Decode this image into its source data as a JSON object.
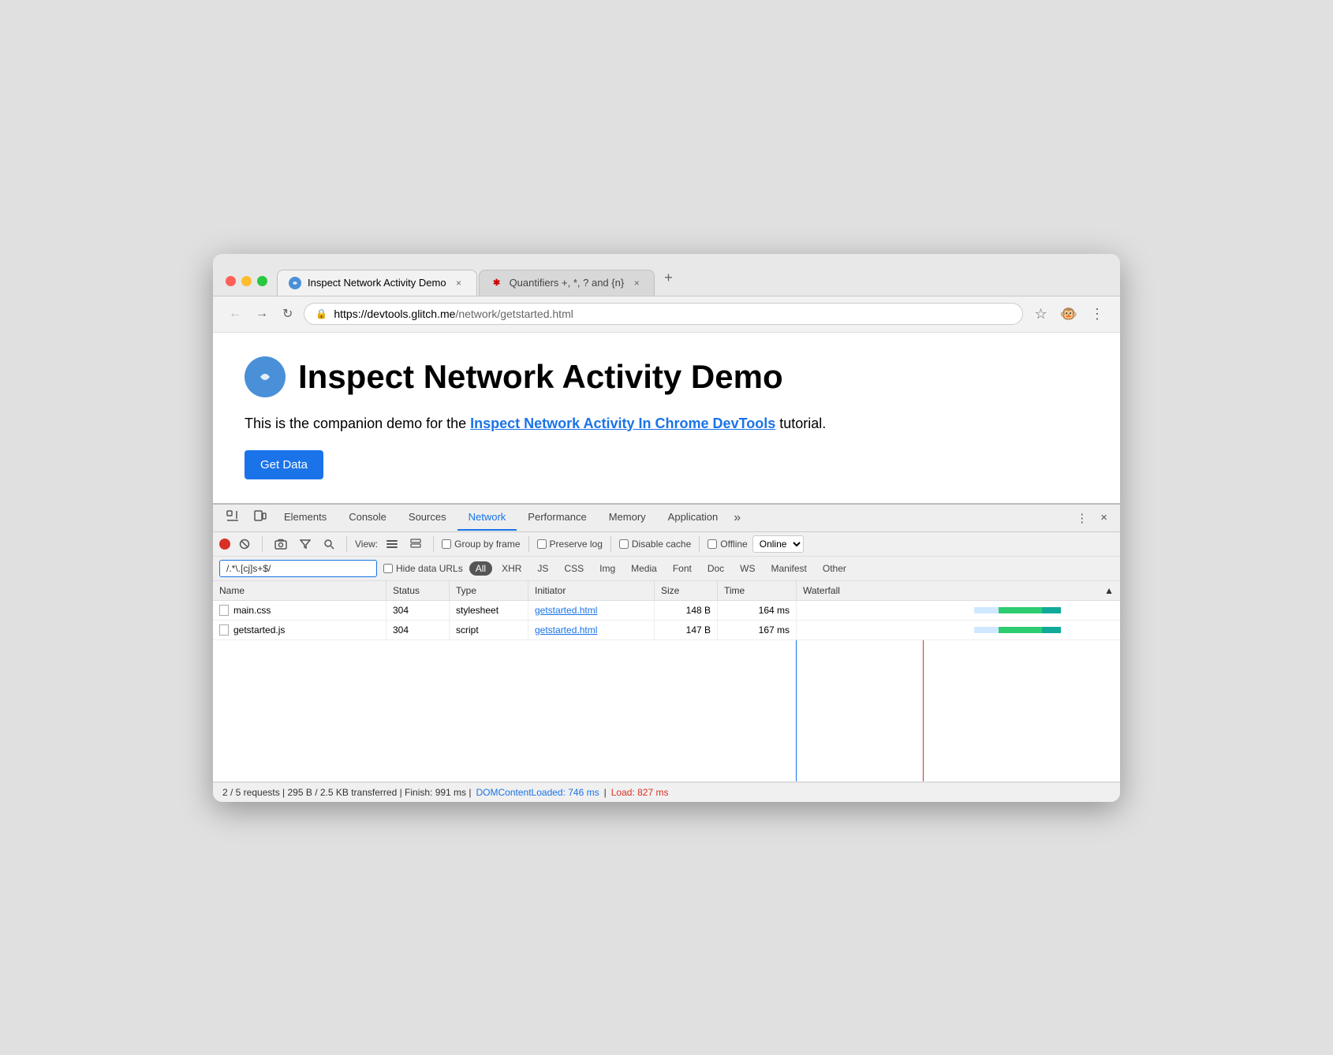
{
  "browser": {
    "tabs": [
      {
        "id": "tab1",
        "title": "Inspect Network Activity Demo",
        "favicon": "glitch",
        "active": true
      },
      {
        "id": "tab2",
        "title": "Quantifiers +, *, ? and {n}",
        "favicon": "regex",
        "active": false
      }
    ],
    "new_tab_label": "+",
    "back_btn": "←",
    "forward_btn": "→",
    "reload_btn": "↻",
    "url": "https://devtools.glitch.me/network/getstarted.html",
    "url_protocol": "https://",
    "url_domain": "devtools.glitch.me",
    "url_path": "/network/getstarted.html",
    "bookmark_icon": "☆",
    "avatar_icon": "🐵",
    "more_icon": "⋮"
  },
  "page": {
    "title": "Inspect Network Activity Demo",
    "description_prefix": "This is the companion demo for the ",
    "link_text": "Inspect Network Activity In Chrome DevTools",
    "description_suffix": " tutorial.",
    "button_label": "Get Data"
  },
  "devtools": {
    "panel_icon_cursor": "⬚",
    "panel_icon_device": "⬜",
    "tabs": [
      {
        "id": "elements",
        "label": "Elements",
        "active": false
      },
      {
        "id": "console",
        "label": "Console",
        "active": false
      },
      {
        "id": "sources",
        "label": "Sources",
        "active": false
      },
      {
        "id": "network",
        "label": "Network",
        "active": true
      },
      {
        "id": "performance",
        "label": "Performance",
        "active": false
      },
      {
        "id": "memory",
        "label": "Memory",
        "active": false
      },
      {
        "id": "application",
        "label": "Application",
        "active": false
      }
    ],
    "more_tabs": "»",
    "more_options": "⋮",
    "close": "×",
    "network": {
      "toolbar": {
        "record_title": "Record network log",
        "clear_title": "Clear",
        "camera_icon": "🎥",
        "filter_icon": "▽",
        "search_icon": "🔍",
        "view_label": "View:",
        "list_view_title": "Use large request rows",
        "group_by_frame_label": "Group by frame",
        "preserve_log_label": "Preserve log",
        "disable_cache_label": "Disable cache",
        "offline_label": "Offline",
        "online_label": "Online",
        "throttle_arrow": "▾"
      },
      "filter": {
        "input_value": "/.*\\.[cj]s+$/",
        "hide_data_urls_label": "Hide data URLs",
        "types": [
          "All",
          "XHR",
          "JS",
          "CSS",
          "Img",
          "Media",
          "Font",
          "Doc",
          "WS",
          "Manifest",
          "Other"
        ],
        "active_type": "All"
      },
      "table": {
        "columns": [
          "Name",
          "Status",
          "Type",
          "Initiator",
          "Size",
          "Time",
          "Waterfall"
        ],
        "sort_arrow": "▲",
        "rows": [
          {
            "name": "main.css",
            "status": "304",
            "type": "stylesheet",
            "initiator": "getstarted.html",
            "size": "148 B",
            "time": "164 ms",
            "waterfall_wait_pct": 60,
            "waterfall_recv_pct": 35
          },
          {
            "name": "getstarted.js",
            "status": "304",
            "type": "script",
            "initiator": "getstarted.html",
            "size": "147 B",
            "time": "167 ms",
            "waterfall_wait_pct": 60,
            "waterfall_recv_pct": 35
          }
        ]
      },
      "status_bar": "2 / 5 requests | 295 B / 2.5 KB transferred | Finish: 991 ms | DOMContentLoaded: 746 ms | Load: 827 ms",
      "status_parts": {
        "base": "2 / 5 requests | 295 B / 2.5 KB transferred | Finish: 991 ms | ",
        "dom_label": "DOMContentLoaded: 746 ms",
        "separator": " | ",
        "load_label": "Load: 827 ms"
      }
    }
  }
}
